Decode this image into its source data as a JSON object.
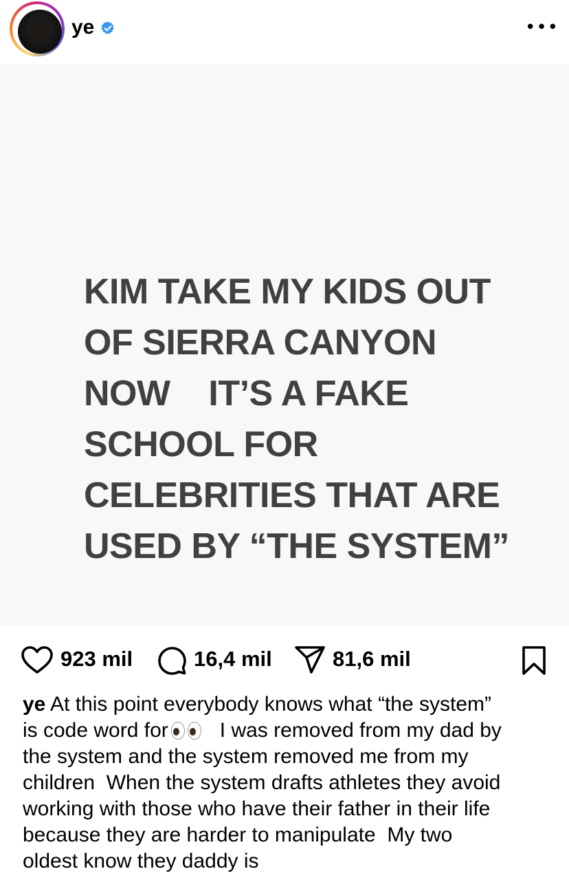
{
  "header": {
    "username": "ye",
    "verified": true,
    "more_label": "•••",
    "accent_ring_colors": [
      "#feda75",
      "#fa7e1e",
      "#d62976",
      "#962fbf",
      "#4f5bd5"
    ],
    "verified_color": "#3897f0"
  },
  "post": {
    "image_text_lines": [
      "KIM TAKE MY KIDS OUT",
      "OF SIERRA CANYON",
      "NOW    IT’S A FAKE",
      "SCHOOL FOR",
      "CELEBRITIES THAT ARE",
      "USED BY “THE SYSTEM”"
    ],
    "background_color": "#f8f8f8",
    "text_color": "#404040"
  },
  "actions": {
    "likes": "923 mil",
    "comments": "16,4 mil",
    "shares": "81,6 mil"
  },
  "caption": {
    "username": "ye",
    "lines": [
      " At this point everybody knows what “the system”",
      "is code word for",
      "   I was removed from my dad by",
      "the system and the system removed me from my",
      "children  When the system drafts athletes they avoid",
      "working with those who have their father in their life",
      "because they are harder to manipulate  My two",
      "oldest know they daddy is"
    ],
    "emoji_icon": "eyes-emoji-icon"
  }
}
